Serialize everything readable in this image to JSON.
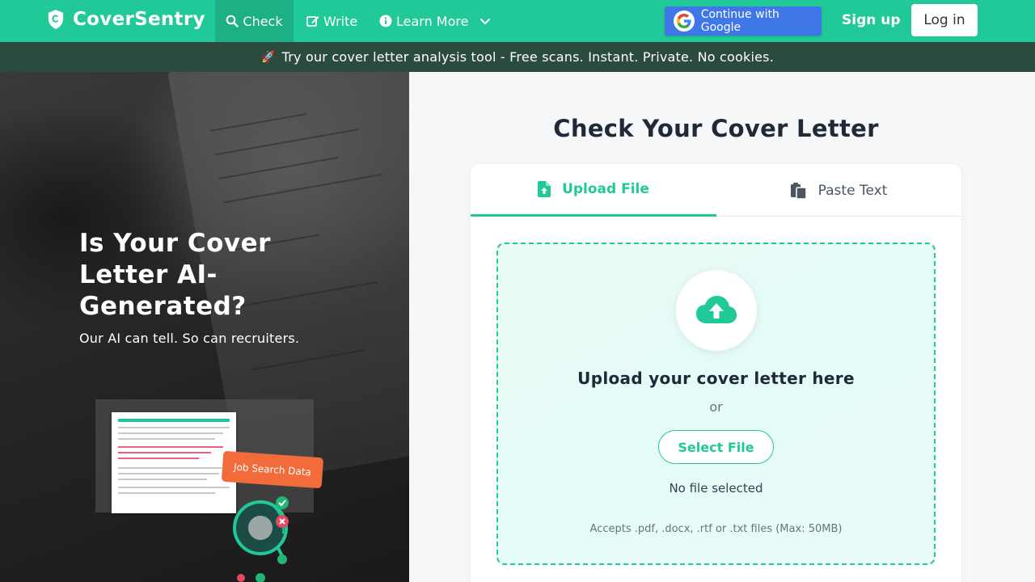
{
  "navbar": {
    "brand": "CoverSentry",
    "links": [
      {
        "label": "Check",
        "icon": "search-icon"
      },
      {
        "label": "Write",
        "icon": "edit-icon"
      },
      {
        "label": "Learn More",
        "icon": "info-icon"
      }
    ],
    "google_label": "Continue with Google",
    "signup_label": "Sign up",
    "login_label": "Log in"
  },
  "announcement": {
    "icon": "rocket-icon",
    "text": "Try our cover letter analysis tool - Free scans. Instant. Private. No cookies."
  },
  "hero": {
    "title": "Is Your Cover Letter AI-Generated?",
    "subtitle": "Our AI can tell. So can recruiters.",
    "tag_label": "Job Search Data"
  },
  "checker": {
    "title": "Check Your Cover Letter",
    "tabs": [
      {
        "label": "Upload File",
        "icon": "file-upload-icon",
        "active": true
      },
      {
        "label": "Paste Text",
        "icon": "clipboard-icon",
        "active": false
      }
    ],
    "dropzone_title": "Upload your cover letter here",
    "or_text": "or",
    "select_label": "Select File",
    "status": "No file selected",
    "accepts": "Accepts .pdf, .docx, .rtf or .txt files (Max: 50MB)"
  },
  "colors": {
    "brand": "#20c997",
    "announcement_bg": "#2b4b3f",
    "google_blue": "#3f77e8",
    "job_tag": "#f26b3a"
  }
}
